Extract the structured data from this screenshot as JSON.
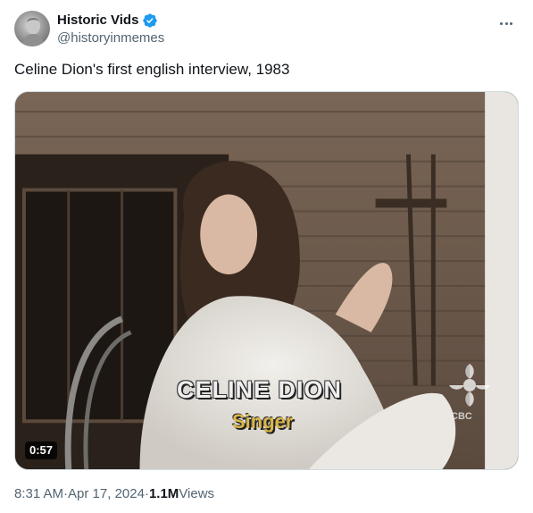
{
  "author": {
    "display_name": "Historic Vids",
    "handle": "@historyinmemes",
    "verified_badge_color": "#1d9bf0",
    "avatar_icon": "bust-portrait-avatar"
  },
  "tweet": {
    "text": "Celine Dion's first english interview, 1983"
  },
  "media": {
    "caption_name": "CELINE DION",
    "caption_role": "Singer",
    "watermark": "CBC",
    "duration": "0:57"
  },
  "meta": {
    "time": "8:31 AM",
    "separator": " · ",
    "date": "Apr 17, 2024",
    "views_count": "1.1M",
    "views_label": " Views"
  },
  "colors": {
    "text_primary": "#0f1419",
    "text_secondary": "#536471",
    "border": "#cfd9de"
  }
}
